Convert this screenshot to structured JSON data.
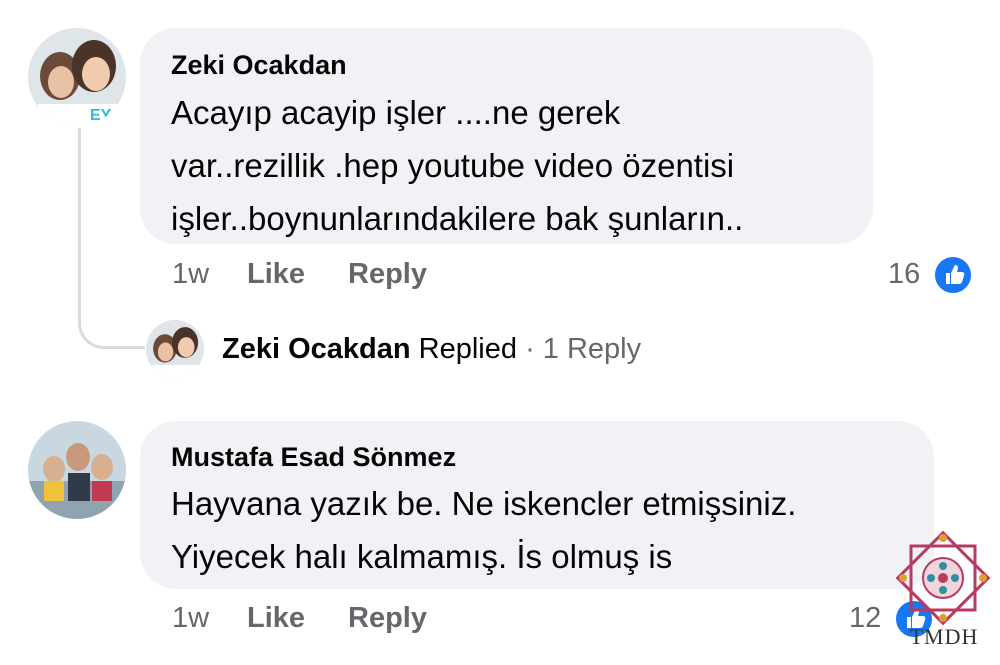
{
  "comments": [
    {
      "author": "Zeki Ocakdan",
      "lines": [
        "Acayıp acayip işler ....ne gerek",
        "var..rezillik .hep youtube video özentisi",
        "işler..boynunlarındakilere bak şunların.."
      ],
      "time": "1w",
      "like_label": "Like",
      "reply_label": "Reply",
      "reaction_count": "16",
      "reaction_icon": "like-thumb-icon",
      "replies_summary": {
        "author": "Zeki Ocakdan",
        "action": "Replied",
        "separator": "·",
        "count_label": "1 Reply"
      }
    },
    {
      "author": "Mustafa Esad Sönmez",
      "lines": [
        "Hayvana yazık be. Ne iskencler etmişsiniz.",
        "Yiyecek halı kalmamış. İs olmuş is"
      ],
      "time": "1w",
      "like_label": "Like",
      "reply_label": "Reply",
      "reaction_count": "12",
      "reaction_icon": "like-thumb-icon"
    }
  ],
  "watermark": {
    "text": "TMDH"
  },
  "colors": {
    "bubble": "#f0f2f5",
    "meta": "#65676b",
    "like_blue": "#1877f2",
    "watermark": "#b83a5e"
  }
}
